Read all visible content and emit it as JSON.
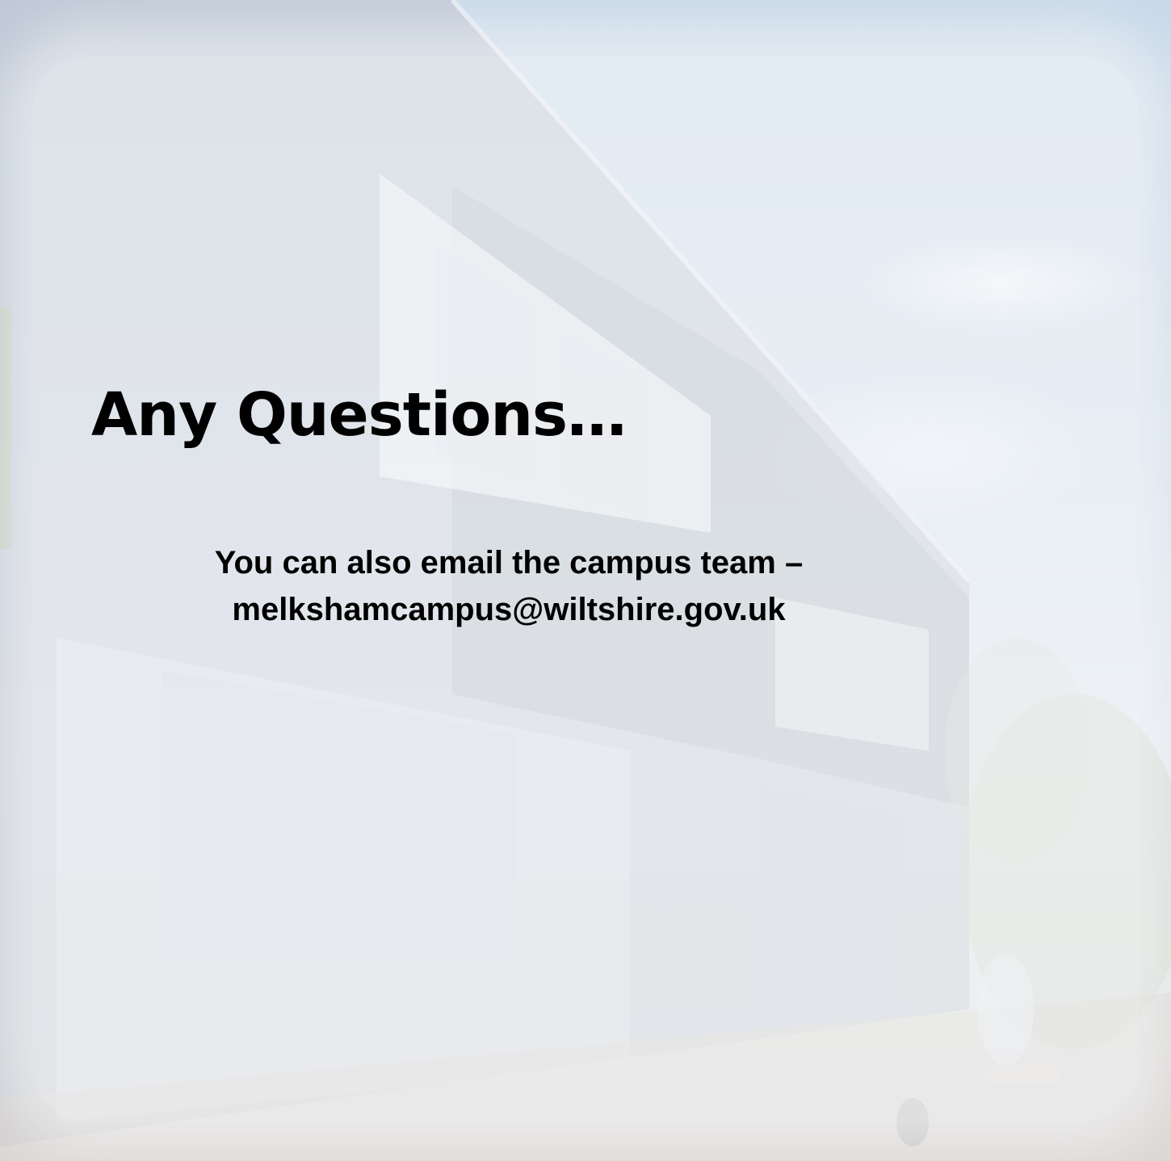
{
  "slide": {
    "title": "Any Questions…",
    "contact_line": "You can also email the campus team –",
    "email": "melkshamcampus@wiltshire.gov.uk"
  },
  "background": {
    "description_icon": "building-photo"
  }
}
